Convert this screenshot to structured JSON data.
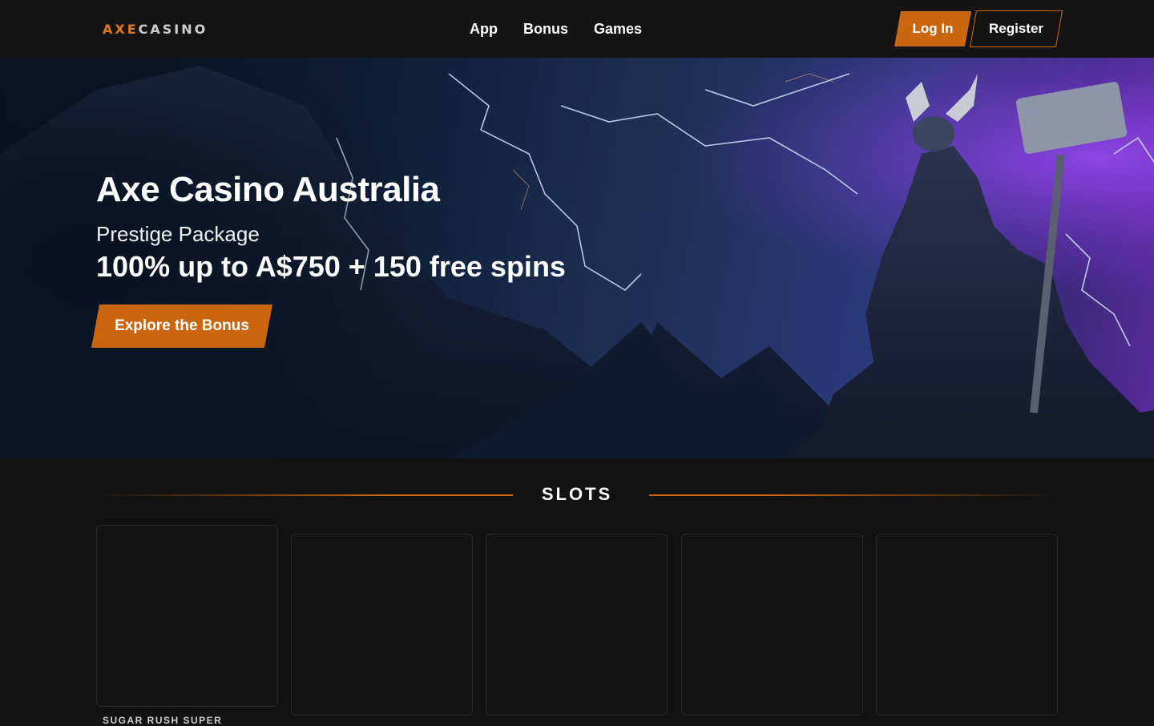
{
  "header": {
    "logo_text_a": "AXE",
    "logo_text_b": "CASINO",
    "nav": [
      {
        "label": "App"
      },
      {
        "label": "Bonus"
      },
      {
        "label": "Games"
      }
    ],
    "login_label": "Log In",
    "register_label": "Register"
  },
  "hero": {
    "title": "Axe Casino Australia",
    "subtitle": "Prestige Package",
    "offer": "100% up to A$750 + 150 free spins",
    "cta_label": "Explore the Bonus"
  },
  "slots": {
    "title": "SLOTS",
    "cards": [
      {
        "label": "SUGAR RUSH SUPER"
      },
      {
        "label": ""
      },
      {
        "label": ""
      },
      {
        "label": ""
      },
      {
        "label": ""
      }
    ]
  },
  "colors": {
    "accent": "#c9660f",
    "background": "#121212",
    "header": "#141414"
  }
}
